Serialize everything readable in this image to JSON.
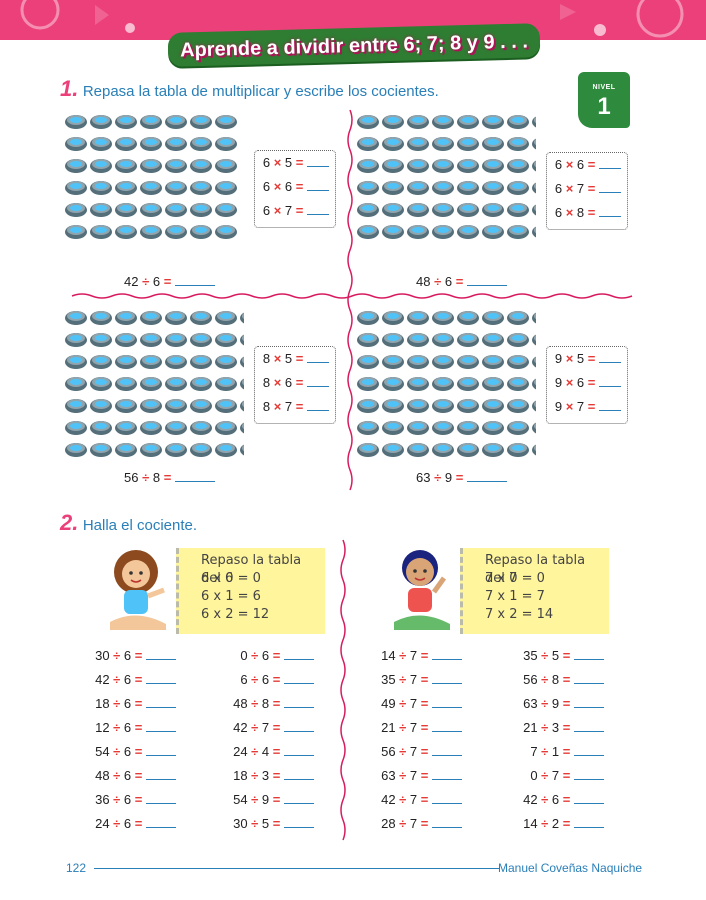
{
  "header": {
    "title": "Aprende a dividir entre 6; 7; 8 y 9 . . ."
  },
  "level": {
    "label": "NIVEL",
    "number": "1"
  },
  "section1": {
    "number": "1.",
    "instruction": "Repasa la tabla de multiplicar y escribe los cocientes.",
    "groups": [
      {
        "hints": [
          "6 × 5 =",
          "6 × 6 =",
          "6 × 7 ="
        ],
        "question": "42 ÷ 6 =",
        "rows": 6,
        "cols": 7
      },
      {
        "hints": [
          "6 × 6 =",
          "6 × 7 =",
          "6 × 8 ="
        ],
        "question": "48 ÷ 6 =",
        "rows": 6,
        "cols": 8
      },
      {
        "hints": [
          "8 × 5 =",
          "8 × 6 =",
          "8 × 7 ="
        ],
        "question": "56 ÷ 8 =",
        "rows": 7,
        "cols": 8
      },
      {
        "hints": [
          "9 × 5 =",
          "9 × 6 =",
          "9 × 7 ="
        ],
        "question": "63 ÷ 9 =",
        "rows": 7,
        "cols": 9
      }
    ]
  },
  "section2": {
    "number": "2.",
    "instruction": "Halla el cociente.",
    "note_left": [
      "Repaso la tabla del 6",
      "6 x 0 = 0",
      "6 x 1 = 6",
      "6 x 2 = 12"
    ],
    "note_right": [
      "Repaso la tabla del 7",
      "7 x 0 = 0",
      "7 x 1 = 7",
      "7 x 2 = 14"
    ],
    "col1": [
      "30 ÷ 6 =",
      "42 ÷ 6 =",
      "18 ÷ 6 =",
      "12 ÷ 6 =",
      "54 ÷ 6 =",
      "48 ÷ 6 =",
      "36 ÷ 6 =",
      "24 ÷ 6 ="
    ],
    "col2": [
      "0 ÷ 6 =",
      "6 ÷ 6 =",
      "48 ÷ 8 =",
      "42 ÷ 7 =",
      "24 ÷ 4 =",
      "18 ÷ 3 =",
      "54 ÷ 9 =",
      "30 ÷ 5 ="
    ],
    "col3": [
      "14 ÷ 7 =",
      "35 ÷ 7 =",
      "49 ÷ 7 =",
      "21 ÷ 7 =",
      "56 ÷ 7 =",
      "63 ÷ 7 =",
      "42 ÷ 7 =",
      "28 ÷ 7 ="
    ],
    "col4": [
      "35 ÷ 5 =",
      "56 ÷ 8 =",
      "63 ÷ 9 =",
      "21 ÷ 3 =",
      "7 ÷ 1 =",
      "0 ÷ 7 =",
      "42 ÷ 6 =",
      "14 ÷ 2 ="
    ]
  },
  "footer": {
    "page": "122",
    "author": "Manuel Coveñas Naquiche"
  },
  "colors": {
    "accent_pink": "#ec407a",
    "accent_blue": "#2a7fb8",
    "accent_green": "#2e7d32",
    "accent_red": "#e53935"
  }
}
